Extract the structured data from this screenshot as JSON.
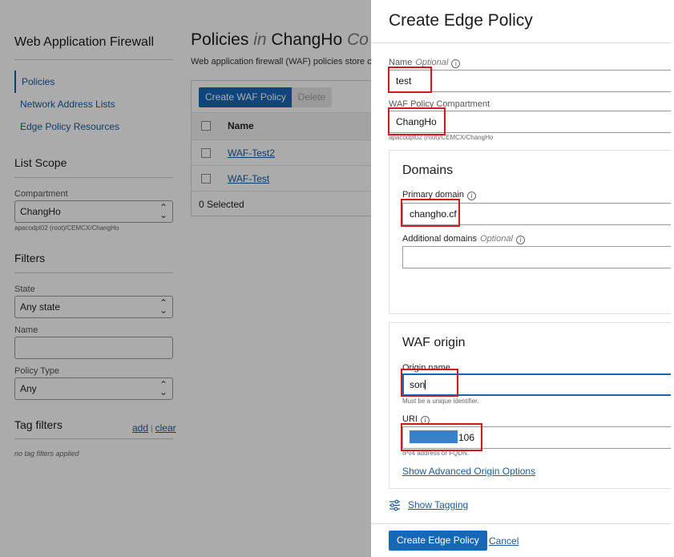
{
  "sidebar": {
    "title": "Web Application Firewall",
    "nav": [
      "Policies",
      "Network Address Lists",
      "Edge Policy Resources"
    ],
    "list_scope": "List Scope",
    "compartment_label": "Compartment",
    "compartment_value": "ChangHo",
    "compartment_path": "apacodpt02 (root)/CEMCX/ChangHo",
    "filters": "Filters",
    "state_label": "State",
    "state_value": "Any state",
    "name_label": "Name",
    "policy_type_label": "Policy Type",
    "policy_type_value": "Any",
    "tag_filters": "Tag filters",
    "tag_add": "add",
    "tag_sep": "|",
    "tag_clear": "clear",
    "no_tags": "no tag filters applied"
  },
  "main": {
    "title_prefix": "Policies",
    "title_in": "in",
    "title_compartment": "ChangHo",
    "title_tail": "Co",
    "description": "Web application firewall (WAF) policies store c",
    "create_button": "Create WAF Policy",
    "delete_button": "Delete",
    "column_name": "Name",
    "rows": [
      "WAF-Test2",
      "WAF-Test"
    ],
    "selected_count": "0 Selected"
  },
  "panel": {
    "title": "Create Edge Policy",
    "name_label": "Name",
    "optional": "Optional",
    "name_value": "test",
    "compartment_label": "WAF Policy Compartment",
    "compartment_value": "ChangHo",
    "compartment_path": "apacodpt02 (root)/CEMCX/ChangHo",
    "domains_title": "Domains",
    "primary_domain_label": "Primary domain",
    "primary_domain_value": "changho.cf",
    "additional_domains_label": "Additional domains",
    "additional_optional": "Optional",
    "waf_origin_title": "WAF origin",
    "origin_name_label": "Origin name",
    "origin_name_value": "son",
    "origin_name_hint": "Must be a unique identifier.",
    "uri_label": "URI",
    "uri_value_suffix": "106",
    "uri_hint": "IPv4 address or FQDN.",
    "advanced_link": "Show Advanced Origin Options",
    "show_tagging": "Show Tagging",
    "create_button": "Create Edge Policy",
    "cancel": "Cancel"
  },
  "icons": {
    "info": "info-icon",
    "chevron": "chevron-updown-icon",
    "tagging": "sliders-icon"
  },
  "colors": {
    "primary": "#1568b8",
    "link": "#1a5a96",
    "annotation": "#d21a1a",
    "redaction": "#3a80c9"
  }
}
